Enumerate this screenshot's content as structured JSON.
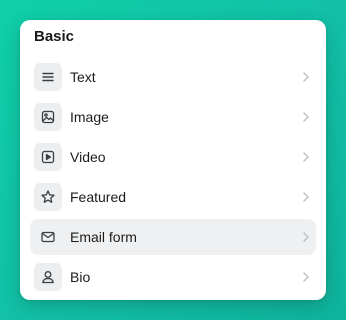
{
  "panel": {
    "title": "Basic",
    "items": [
      {
        "label": "Text",
        "icon": "text-lines-icon"
      },
      {
        "label": "Image",
        "icon": "image-icon"
      },
      {
        "label": "Video",
        "icon": "video-play-icon"
      },
      {
        "label": "Featured",
        "icon": "star-icon"
      },
      {
        "label": "Email form",
        "icon": "envelope-icon",
        "selected": true
      },
      {
        "label": "Bio",
        "icon": "user-icon"
      }
    ]
  },
  "colors": {
    "background": "#12bfa6",
    "panel": "#ffffff",
    "selected_row": "#eef0f2",
    "icon_tile": "#eceef0",
    "icon_stroke": "#3a3f45",
    "chevron": "#b8bcc2"
  }
}
